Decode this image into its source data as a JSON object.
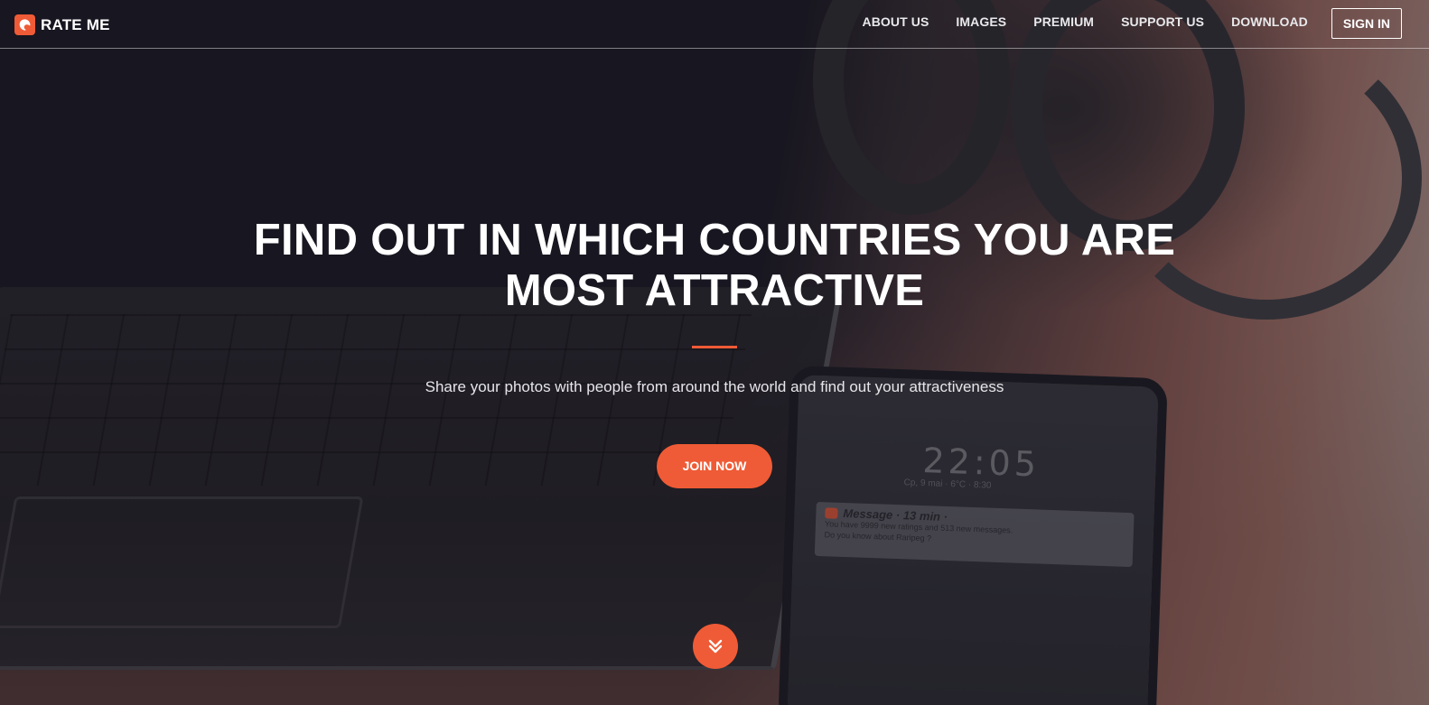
{
  "brand": {
    "name": "RATE ME",
    "logo_icon": "rateme-logo-icon",
    "accent_color": "#ef5b36"
  },
  "nav": {
    "items": [
      {
        "label": "ABOUT US"
      },
      {
        "label": "IMAGES"
      },
      {
        "label": "PREMIUM"
      },
      {
        "label": "SUPPORT US"
      },
      {
        "label": "DOWNLOAD"
      }
    ],
    "signin_label": "SIGN IN"
  },
  "hero": {
    "title_line1": "FIND OUT IN WHICH COUNTRIES YOU ARE",
    "title_line2": "MOST ATTRACTIVE",
    "subtitle": "Share your photos with people from around the world and find out your attractiveness",
    "cta_label": "JOIN NOW",
    "scroll_icon": "chevron-double-down-icon"
  },
  "background_phone": {
    "time": "22:05",
    "status": "Cp, 9 mai  ·  6°C  ·  8:30",
    "notification_title": "Message · 13 min ·",
    "notification_line1": "You have 9999 new ratings and 513 new messages.",
    "notification_line2": "Do you know about Raripeg ?"
  }
}
